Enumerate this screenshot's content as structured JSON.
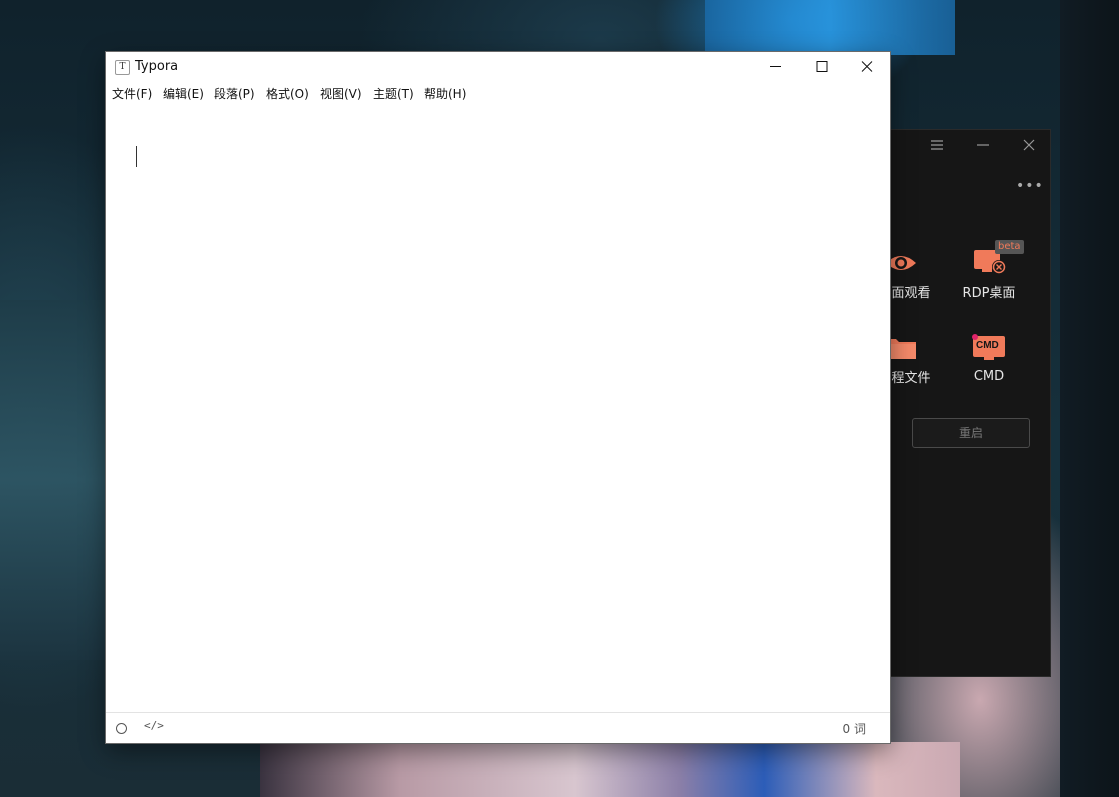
{
  "typora": {
    "title": "Typora",
    "app_icon_letter": "T",
    "menu": [
      "文件(F)",
      "编辑(E)",
      "段落(P)",
      "格式(O)",
      "视图(V)",
      "主题(T)",
      "帮助(H)"
    ],
    "status": {
      "code_toggle": "</>",
      "word_count": "0 词"
    }
  },
  "remote_panel": {
    "more_label": "•••",
    "tiles": [
      {
        "label": "面观看",
        "icon": "eye-icon"
      },
      {
        "label": "RDP桌面",
        "icon": "rdp-desktop-icon",
        "badge": "beta"
      },
      {
        "label": "程文件",
        "icon": "folder-icon"
      },
      {
        "label": "CMD",
        "icon": "cmd-icon",
        "icon_text": "CMD"
      }
    ],
    "restart_label": "重启",
    "accent": "#f07a5a"
  }
}
